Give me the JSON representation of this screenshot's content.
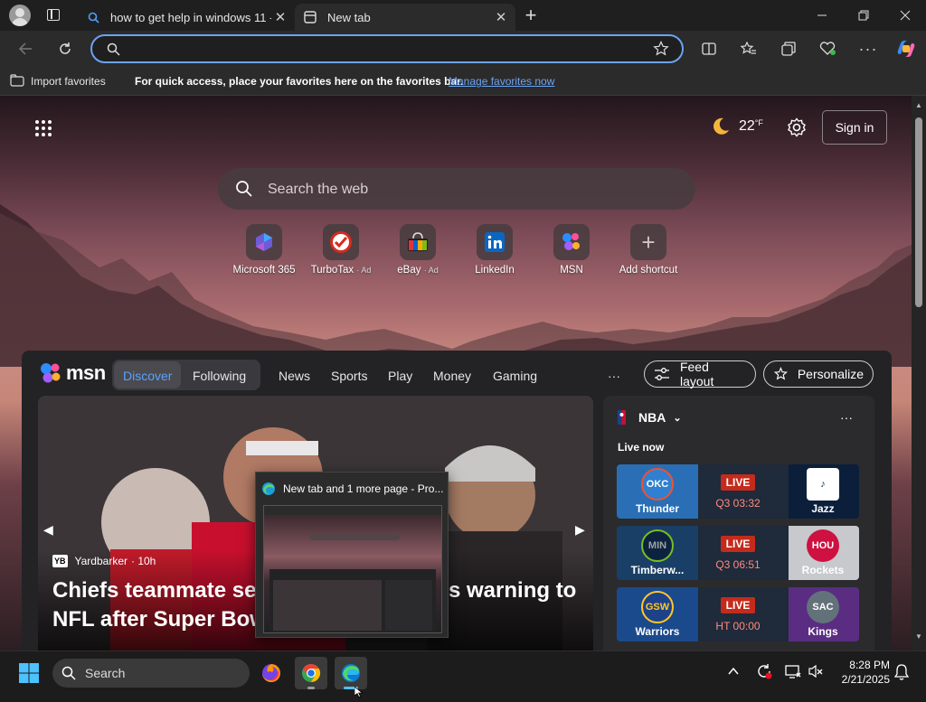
{
  "tabs": [
    {
      "title": "how to get help in windows 11 - B",
      "close": "✕"
    },
    {
      "title": "New tab",
      "close": "✕"
    }
  ],
  "toolbar": {
    "address_value": ""
  },
  "favbar": {
    "import_label": "Import favorites",
    "message": "For quick access, place your favorites here on the favorites bar.",
    "manage_link": "Manage favorites now"
  },
  "ntp": {
    "weather_temp": "22",
    "weather_unit": "°F",
    "sign_in": "Sign in",
    "search_placeholder": "Search the web",
    "shortcuts": [
      {
        "label": "Microsoft 365",
        "ad": ""
      },
      {
        "label": "TurboTax",
        "ad": "· Ad"
      },
      {
        "label": "eBay",
        "ad": "· Ad"
      },
      {
        "label": "LinkedIn",
        "ad": ""
      },
      {
        "label": "MSN",
        "ad": ""
      },
      {
        "label": "Add shortcut",
        "ad": ""
      }
    ]
  },
  "msn": {
    "logo": "msn",
    "nav": [
      "Discover",
      "Following",
      "News",
      "Sports",
      "Play",
      "Money",
      "Gaming"
    ],
    "more": "···",
    "feed_layout": "Feed layout",
    "personalize": "Personalize",
    "hero": {
      "source_badge": "YB",
      "source": "Yardbarker",
      "age": "· 10h",
      "headline_line1": "Chiefs teammate ser",
      "headline_line1b": "s warning to",
      "headline_line2": "NFL after Super Bow"
    },
    "nba": {
      "league": "NBA",
      "more": "···",
      "live_now": "Live now",
      "games": [
        {
          "home": "Thunder",
          "away": "Jazz",
          "status": "LIVE",
          "clock": "Q3 03:32",
          "home_color": "#2a6fb5",
          "away_color": "#0b1f3b"
        },
        {
          "home": "Timberw...",
          "away": "Rockets",
          "status": "LIVE",
          "clock": "Q3 06:51",
          "home_color": "#1a3f66",
          "away_color": "#7a1d24"
        },
        {
          "home": "Warriors",
          "away": "Kings",
          "status": "LIVE",
          "clock": "HT 00:00",
          "home_color": "#1b4a8c",
          "away_color": "#5a2d82"
        }
      ]
    }
  },
  "preview": {
    "title": "New tab and 1 more page - Pro..."
  },
  "taskbar": {
    "search_label": "Search",
    "time": "8:28 PM",
    "date": "2/21/2025"
  }
}
